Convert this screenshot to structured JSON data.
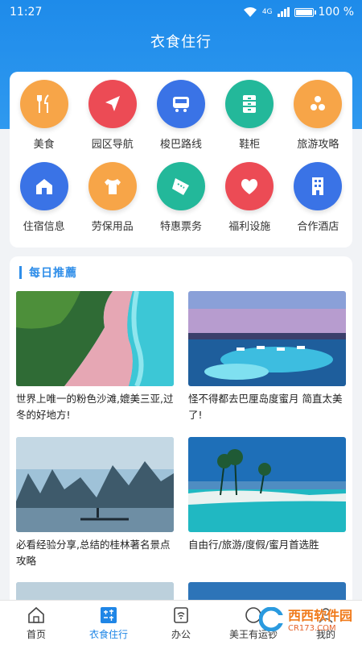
{
  "status": {
    "time": "11:27",
    "network": "4G",
    "battery": "100 %",
    "battery_level": 1.0
  },
  "header": {
    "title": "衣食住行"
  },
  "grid": [
    {
      "label": "美食",
      "icon": "fork-knife-icon",
      "color": "#f7a548"
    },
    {
      "label": "园区导航",
      "icon": "navigation-arrow-icon",
      "color": "#ec4b55"
    },
    {
      "label": "梭巴路线",
      "icon": "shuttle-bus-icon",
      "color": "#3a73e6"
    },
    {
      "label": "鞋柜",
      "icon": "cabinet-icon",
      "color": "#23b89a"
    },
    {
      "label": "旅游攻略",
      "icon": "travel-icon",
      "color": "#f7a548"
    },
    {
      "label": "住宿信息",
      "icon": "house-icon",
      "color": "#3a73e6"
    },
    {
      "label": "劳保用品",
      "icon": "shirt-icon",
      "color": "#f7a548"
    },
    {
      "label": "特惠票务",
      "icon": "ticket-icon",
      "color": "#23b89a"
    },
    {
      "label": "福利设施",
      "icon": "heart-icon",
      "color": "#ec4b55"
    },
    {
      "label": "合作酒店",
      "icon": "hotel-building-icon",
      "color": "#3a73e6"
    }
  ],
  "recommend": {
    "title": "每日推薦",
    "items": [
      {
        "caption": "世界上唯一的粉色沙滩,媲美三亚,过冬的好地方!"
      },
      {
        "caption": "怪不得都去巴厘岛度蜜月 简直太美了!"
      },
      {
        "caption": "必看经验分享,总结的桂林著名景点攻略"
      },
      {
        "caption": "自由行/旅游/度假/蜜月首选胜"
      }
    ]
  },
  "tabs": [
    {
      "label": "首页",
      "icon": "home-icon"
    },
    {
      "label": "衣食住行",
      "icon": "clothing-food-icon"
    },
    {
      "label": "办公",
      "icon": "office-icon"
    },
    {
      "label": "美王有运钞",
      "icon": "service-icon"
    },
    {
      "label": "我的",
      "icon": "profile-icon"
    }
  ],
  "watermark": {
    "text": "西西软件园",
    "sub": "CR173.COM"
  }
}
